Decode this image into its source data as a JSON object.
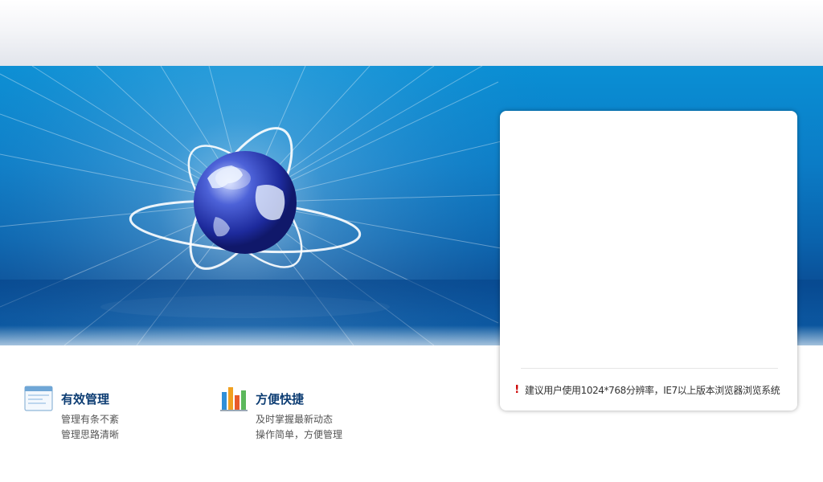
{
  "login_panel": {
    "notice_text": "建议用户使用1024*768分辨率，IE7以上版本浏览器浏览系统",
    "notice_icon": "exclamation-icon"
  },
  "features": [
    {
      "icon": "browser-window-icon",
      "title": "有效管理",
      "lines": [
        "管理有条不紊",
        "管理思路清晰"
      ]
    },
    {
      "icon": "bar-chart-icon",
      "title": "方便快捷",
      "lines": [
        "及时掌握最新动态",
        "操作简单，方便管理"
      ]
    }
  ],
  "colors": {
    "banner_blue": "#0b7cc6",
    "title_blue": "#0d3d73",
    "warning_red": "#cc0000"
  }
}
